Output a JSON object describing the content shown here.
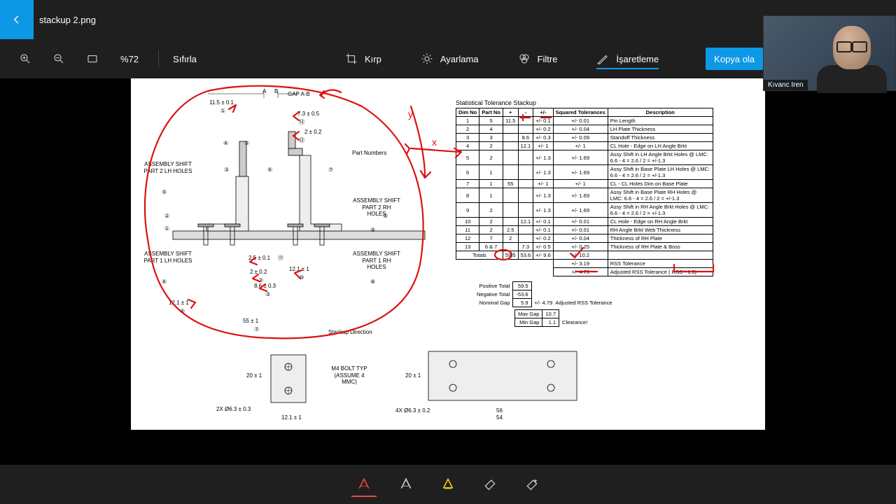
{
  "app": {
    "file_name": "stackup 2.png",
    "zoom": "%72",
    "reset": "Sıfırla"
  },
  "tools": {
    "crop": "Kırp",
    "adjust": "Ayarlama",
    "filter": "Filtre",
    "markup": "İşaretleme",
    "copy": "Kopya ola"
  },
  "webcam": {
    "name": "Kıvanc Iren"
  },
  "drawing": {
    "sts_title": "Statistical Tolerance Stackup",
    "headers": [
      "Dim No",
      "Part No",
      "+",
      "-",
      "+/-",
      "Squared Tolerances",
      "Description"
    ],
    "rows": [
      {
        "dim": "1",
        "part": "5",
        "p": "11.5",
        "m": "",
        "pm": "+/- 0.1",
        "sq": "+/- 0.01",
        "d": "Pin Length"
      },
      {
        "dim": "2",
        "part": "4",
        "p": "",
        "m": "",
        "pm": "+/- 0.2",
        "sq": "+/- 0.04",
        "d": "LH Plate Thickness"
      },
      {
        "dim": "3",
        "part": "3",
        "p": "",
        "m": "8.6",
        "pm": "+/- 0.3",
        "sq": "+/- 0.09",
        "d": "Standoff Thickness"
      },
      {
        "dim": "4",
        "part": "2",
        "p": "",
        "m": "12.1",
        "pm": "+/- 1",
        "sq": "+/- 1",
        "d": "CL Hole - Edge on LH Angle Brkt"
      },
      {
        "dim": "5",
        "part": "2",
        "p": "",
        "m": "",
        "pm": "+/- 1.3",
        "sq": "+/- 1.69",
        "d": "Assy Shift in LH Angle Brkt Holes @ LMC: 6.6 - 4 = 2.6 / 2 = +/-1.3"
      },
      {
        "dim": "6",
        "part": "1",
        "p": "",
        "m": "",
        "pm": "+/- 1.3",
        "sq": "+/- 1.69",
        "d": "Assy Shift in Base Plate LH Holes @ LMC: 6.6 - 4 = 2.6 / 2 = +/-1.3"
      },
      {
        "dim": "7",
        "part": "1",
        "p": "55",
        "m": "",
        "pm": "+/- 1",
        "sq": "+/- 1",
        "d": "CL - CL Holes Dim on Base Plate"
      },
      {
        "dim": "8",
        "part": "1",
        "p": "",
        "m": "",
        "pm": "+/- 1.3",
        "sq": "+/- 1.69",
        "d": "Assy Shift in Base Plate RH Holes @ LMC: 6.6 - 4 = 2.6 / 2 = +/-1.3"
      },
      {
        "dim": "9",
        "part": "2",
        "p": "",
        "m": "",
        "pm": "+/- 1.3",
        "sq": "+/- 1.69",
        "d": "Assy Shift in RH Angle Brkt Holes @ LMC: 6.6 - 4 = 2.6 / 2 = +/-1.3"
      },
      {
        "dim": "10",
        "part": "2",
        "p": "",
        "m": "12.1",
        "pm": "+/- 0.1",
        "sq": "+/- 0.01",
        "d": "CL Hole - Edge on RH Angle Brkt"
      },
      {
        "dim": "11",
        "part": "2",
        "p": "2.5",
        "m": "",
        "pm": "+/- 0.1",
        "sq": "+/- 0.01",
        "d": "RH Angle Brkt Web Thickness"
      },
      {
        "dim": "12",
        "part": "7",
        "p": "2",
        "m": "",
        "pm": "+/- 0.2",
        "sq": "+/- 0.04",
        "d": "Thickness of RH Plate"
      },
      {
        "dim": "13",
        "part": "6 & 7",
        "p": "",
        "m": "7.3",
        "pm": "+/- 0.5",
        "sq": "+/- 0.25",
        "d": "Thickness of RH Plate & Boss"
      }
    ],
    "totals_row": {
      "label": "Totals",
      "p": "59.5",
      "m": "53.6",
      "pm": "+/- 9.6",
      "sq": "+/- 10.2"
    },
    "rss": {
      "pm": "+/- 3.19",
      "label": "RSS Tolerance"
    },
    "adj_rss": {
      "pm": "+/- 4.79",
      "label": "Adjusted RSS Tolerance ( RSS * 1.5)"
    },
    "summary": {
      "pos_lbl": "Positive Total",
      "pos": "59.5",
      "neg_lbl": "Negative Total",
      "neg": "-53.6",
      "gap_lbl": "Nominal Gap",
      "gap": "5.9",
      "gap_pm": "+/- 4.79",
      "gap_note": "Adjusted RSS Tolerance",
      "max_lbl": "Max Gap",
      "max": "10.7",
      "min_lbl": "Min Gap",
      "min": "1.1",
      "clr": "Clearance!"
    },
    "dims": {
      "d1": "11.5 ± 0.1",
      "d1n": "1",
      "gap": "GAP A-B",
      "A": "A",
      "B": "B",
      "d13": "7.3 ± 0.5",
      "d13n": "13",
      "d12": "2 ± 0.2",
      "d12n": "12",
      "pn": "Part Numbers",
      "p4": "4",
      "p5": "5",
      "p3": "3",
      "p6": "6",
      "p7": "7",
      "p2l": "2",
      "p1": "1",
      "p2r": "2",
      "a1": "ASSEMBLY SHIFT PART 2 LH HOLES",
      "a1n": "5",
      "a2": "ASSEMBLY SHIFT PART 1 LH HOLES",
      "a2n": "6",
      "a3": "ASSEMBLY SHIFT PART 2 RH HOLES",
      "a3n": "9",
      "a4": "ASSEMBLY SHIFT PART 1 RH HOLES",
      "a4n": "8",
      "d11": "2.5 ± 0.1",
      "d11n": "11",
      "d2": "2 ± 0.2",
      "d2n": "2",
      "d3": "8.6 ± 0.3",
      "d3n": "3",
      "d4": "12.1 ± 1",
      "d4n": "4",
      "d10": "12.1 ± 1",
      "d10n": "10",
      "d7": "55 ± 1",
      "d7n": "7",
      "stackdir": "Stackup Direction",
      "d20": "20 ± 1",
      "dholes2": "2X Ø6.3 ± 0.3",
      "d121": "12.1 ± 1",
      "bolt": "M4 BOLT TYP (ASSUME 4 MMC)",
      "d20b": "20 ± 1",
      "dholes4": "4X Ø6.3 ± 0.2",
      "d56": "56",
      "d54": "54"
    }
  }
}
